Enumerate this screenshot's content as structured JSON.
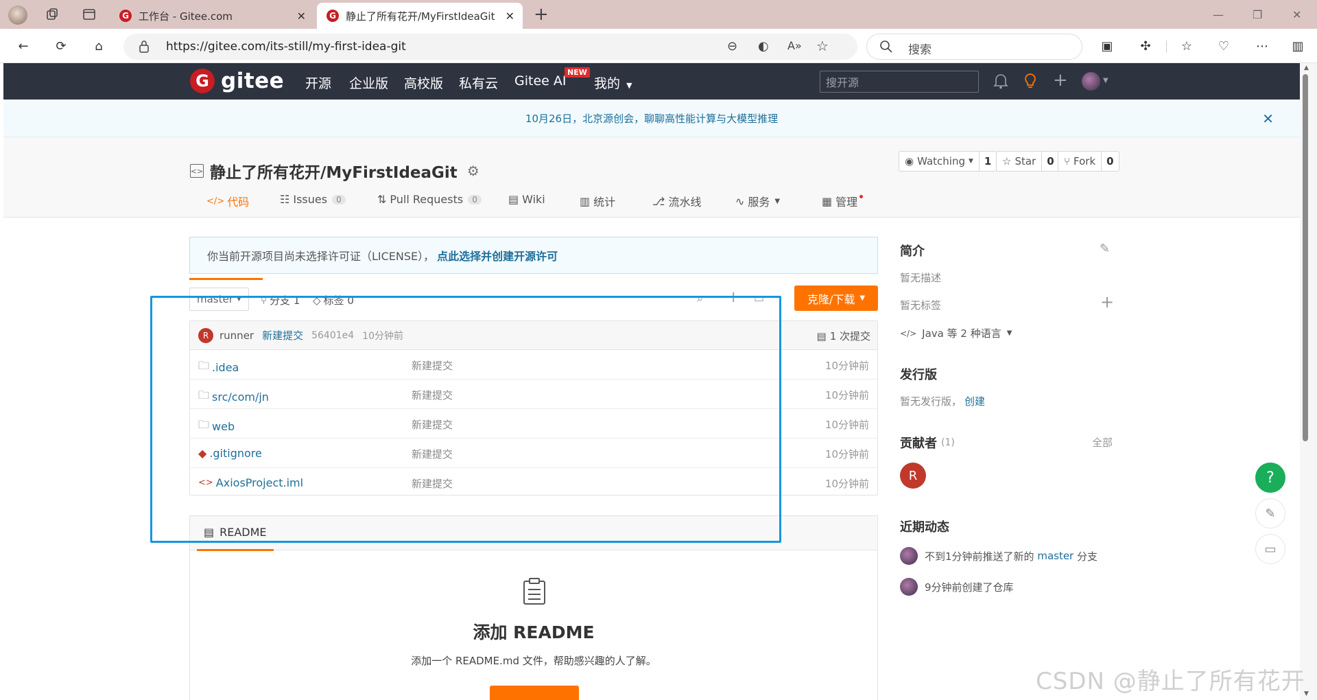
{
  "browser": {
    "tabs": [
      {
        "title": "工作台 - Gitee.com"
      },
      {
        "title": "静止了所有花开/MyFirstIdeaGit"
      }
    ],
    "url": "https://gitee.com/its-still/my-first-idea-git",
    "search_placeholder": "搜索"
  },
  "gitee": {
    "logo_text": "gitee",
    "nav": [
      "开源",
      "企业版",
      "高校版",
      "私有云",
      "Gitee AI",
      "我的"
    ],
    "new_badge": "NEW",
    "search_placeholder": "搜开源"
  },
  "notice": {
    "text": "10月26日，北京源创会，聊聊高性能计算与大模型推理"
  },
  "repo": {
    "title": "静止了所有花开/MyFirstIdeaGit",
    "watching": {
      "label": "Watching",
      "count": "1"
    },
    "star": {
      "label": "Star",
      "count": "0"
    },
    "fork": {
      "label": "Fork",
      "count": "0"
    },
    "tabs": [
      {
        "label": "代码"
      },
      {
        "label": "Issues",
        "count": "0"
      },
      {
        "label": "Pull Requests",
        "count": "0"
      },
      {
        "label": "Wiki"
      },
      {
        "label": "统计"
      },
      {
        "label": "流水线"
      },
      {
        "label": "服务"
      },
      {
        "label": "管理"
      }
    ]
  },
  "license": {
    "text": "你当前开源项目尚未选择许可证（LICENSE），",
    "link": "点此选择并创建开源许可"
  },
  "branch": {
    "name": "master",
    "branches": "分支 1",
    "tags": "标签 0",
    "clone_label": "克隆/下载"
  },
  "commit": {
    "author": "runner",
    "message": "新建提交",
    "hash": "56401e4",
    "time": "10分钟前",
    "count": "1 次提交",
    "avatar": "R"
  },
  "files": [
    {
      "name": ".idea",
      "msg": "新建提交",
      "time": "10分钟前",
      "icon": "folder"
    },
    {
      "name": "src/com/jn",
      "msg": "新建提交",
      "time": "10分钟前",
      "icon": "folder"
    },
    {
      "name": "web",
      "msg": "新建提交",
      "time": "10分钟前",
      "icon": "folder"
    },
    {
      "name": ".gitignore",
      "msg": "新建提交",
      "time": "10分钟前",
      "icon": "git"
    },
    {
      "name": "AxiosProject.iml",
      "msg": "新建提交",
      "time": "10分钟前",
      "icon": "code"
    }
  ],
  "readme": {
    "tab": "README",
    "title": "添加 README",
    "desc": "添加一个 README.md 文件，帮助感兴趣的人了解。"
  },
  "sidebar": {
    "intro_title": "简介",
    "no_desc": "暂无描述",
    "no_tags": "暂无标签",
    "lang": "Java 等 2 种语言",
    "release_title": "发行版",
    "no_release": "暂无发行版，",
    "create": "创建",
    "contrib_title": "贡献者",
    "contrib_count": "(1)",
    "all": "全部",
    "contrib_avatar": "R",
    "activity_title": "近期动态",
    "activities": [
      {
        "text": "不到1分钟前推送了新的 ",
        "link": "master",
        "tail": " 分支"
      },
      {
        "text": "9分钟前创建了仓库"
      }
    ]
  },
  "watermark": "CSDN @静止了所有花开",
  "colors": {
    "accent": "#fe7300",
    "link": "#1e6f9a",
    "header": "#2e3340",
    "highlight": "#1496e0"
  }
}
